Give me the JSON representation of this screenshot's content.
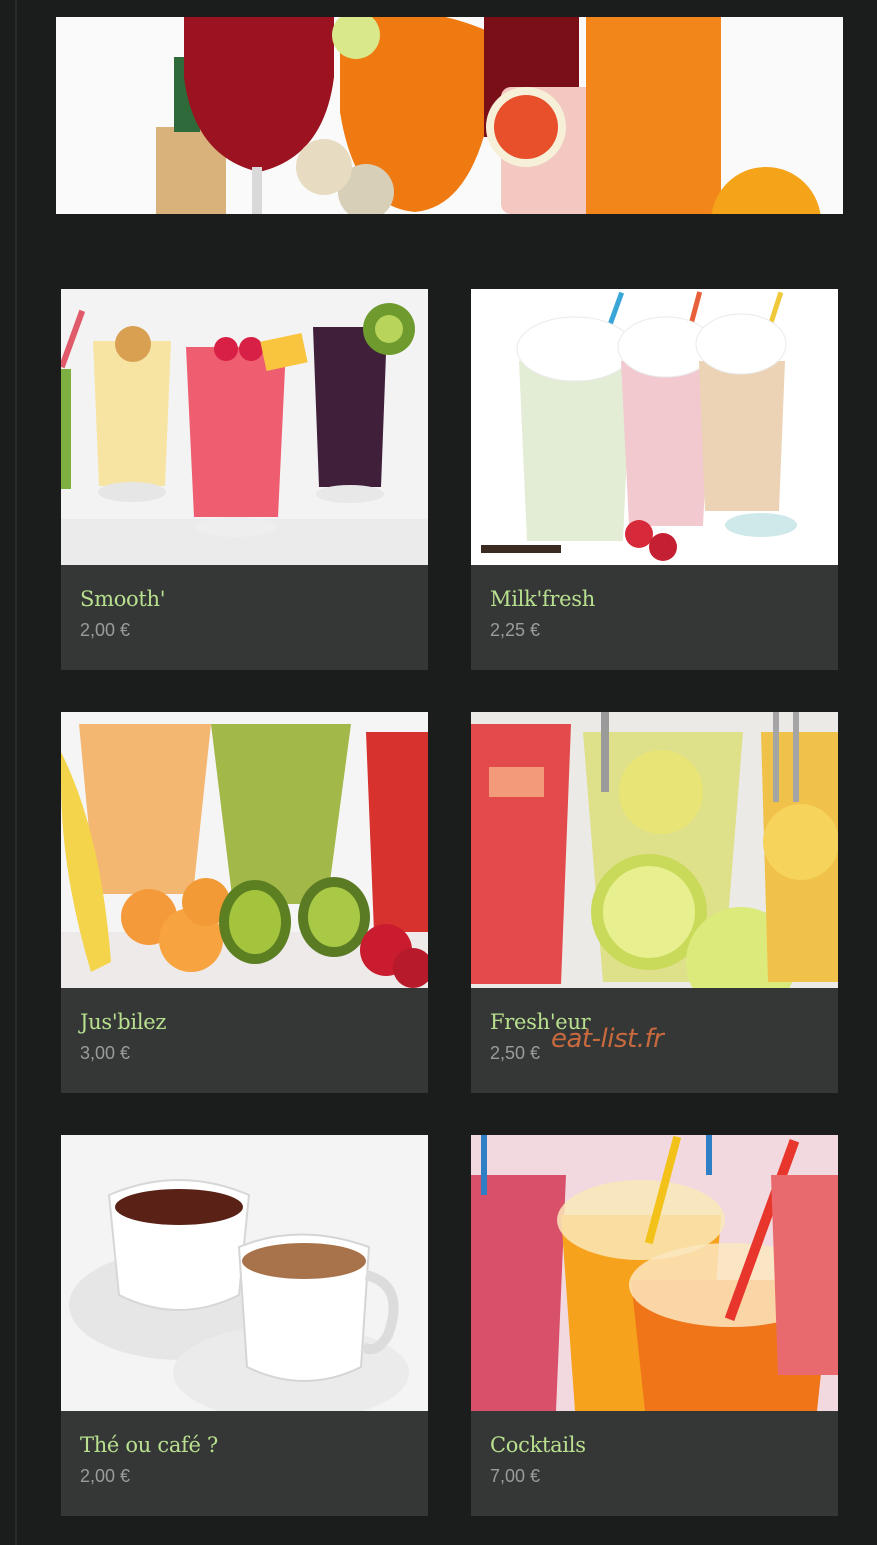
{
  "products": [
    {
      "name": "Smooth'",
      "price": "2,00 €"
    },
    {
      "name": "Milk'fresh",
      "price": "2,25 €"
    },
    {
      "name": "Jus'bilez",
      "price": "3,00 €"
    },
    {
      "name": "Fresh'eur",
      "price": "2,50 €"
    },
    {
      "name": "Thé ou café ?",
      "price": "2,00 €"
    },
    {
      "name": "Cocktails",
      "price": "7,00 €"
    }
  ],
  "watermark": "eat-list.fr",
  "colors": {
    "background": "#1b1c1c",
    "card": "#353737",
    "title": "#b8e08e",
    "price": "#9a9c9c"
  }
}
